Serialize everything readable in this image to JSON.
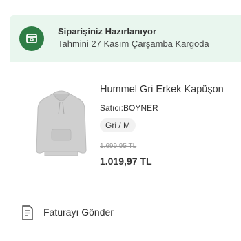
{
  "status": {
    "title": "Siparişiniz Hazırlanıyor",
    "subtitle": "Tahmini 27 Kasım Çarşamba Kargoda",
    "icon": "package-box-icon",
    "accent_color": "#2e7d45",
    "banner_color": "#e9f6ee"
  },
  "product": {
    "name": "Hummel Gri Erkek Kapüşon",
    "seller_label": "Satıcı:",
    "seller_name": "BOYNER",
    "variant": "Gri / M",
    "old_price": "1.699,95 TL",
    "price": "1.019,97 TL",
    "image": "grey-hoodie-image"
  },
  "invoice": {
    "label": "Faturayı Gönder",
    "icon": "document-icon"
  }
}
